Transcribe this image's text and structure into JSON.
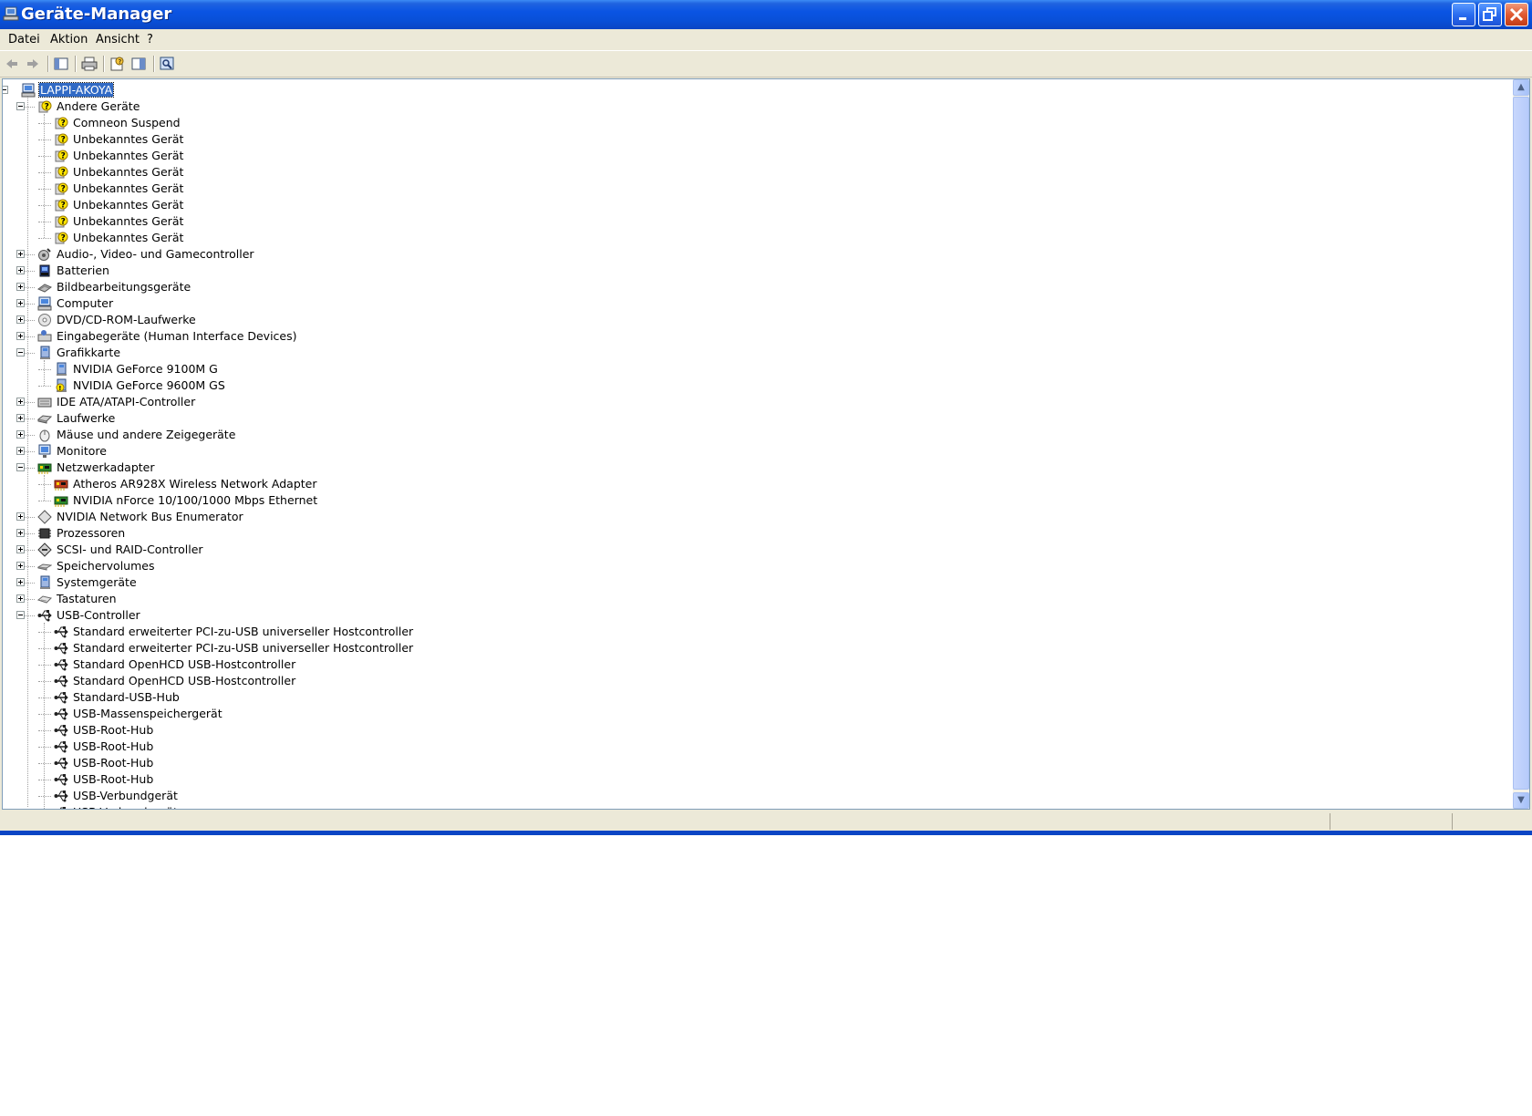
{
  "window": {
    "title": "Geräte-Manager"
  },
  "menu": {
    "items": [
      "Datei",
      "Aktion",
      "Ansicht",
      "?"
    ]
  },
  "toolbar": {
    "buttons": [
      "back-icon",
      "forward-icon",
      "show-hide-tree-icon",
      "print-icon",
      "properties-icon",
      "help-pane-icon",
      "scan-hardware-icon"
    ]
  },
  "tree": {
    "root": "LAPPI-AKOYA",
    "categories": [
      {
        "label": "Andere Geräte",
        "expanded": true,
        "icon": "unknown-device-icon",
        "children": [
          "Comneon Suspend",
          "Unbekanntes Gerät",
          "Unbekanntes Gerät",
          "Unbekanntes Gerät",
          "Unbekanntes Gerät",
          "Unbekanntes Gerät",
          "Unbekanntes Gerät",
          "Unbekanntes Gerät"
        ]
      },
      {
        "label": "Audio-, Video- und Gamecontroller",
        "expanded": false,
        "icon": "audio-icon"
      },
      {
        "label": "Batterien",
        "expanded": false,
        "icon": "battery-icon"
      },
      {
        "label": "Bildbearbeitungsgeräte",
        "expanded": false,
        "icon": "scanner-icon"
      },
      {
        "label": "Computer",
        "expanded": false,
        "icon": "computer-icon"
      },
      {
        "label": "DVD/CD-ROM-Laufwerke",
        "expanded": false,
        "icon": "dvd-icon"
      },
      {
        "label": "Eingabegeräte (Human Interface Devices)",
        "expanded": false,
        "icon": "hid-icon"
      },
      {
        "label": "Grafikkarte",
        "expanded": true,
        "icon": "display-adapter-icon",
        "children": [
          "NVIDIA GeForce 9100M G",
          "NVIDIA GeForce 9600M GS"
        ]
      },
      {
        "label": "IDE ATA/ATAPI-Controller",
        "expanded": false,
        "icon": "ide-icon"
      },
      {
        "label": "Laufwerke",
        "expanded": false,
        "icon": "disk-drive-icon"
      },
      {
        "label": "Mäuse und andere Zeigegeräte",
        "expanded": false,
        "icon": "mouse-icon"
      },
      {
        "label": "Monitore",
        "expanded": false,
        "icon": "monitor-icon"
      },
      {
        "label": "Netzwerkadapter",
        "expanded": true,
        "icon": "network-adapter-icon",
        "children": [
          "Atheros AR928X Wireless Network Adapter",
          "NVIDIA nForce 10/100/1000 Mbps Ethernet"
        ]
      },
      {
        "label": "NVIDIA Network Bus Enumerator",
        "expanded": false,
        "icon": "bus-enumerator-icon"
      },
      {
        "label": "Prozessoren",
        "expanded": false,
        "icon": "processor-icon"
      },
      {
        "label": "SCSI- und RAID-Controller",
        "expanded": false,
        "icon": "scsi-icon"
      },
      {
        "label": "Speichervolumes",
        "expanded": false,
        "icon": "storage-volume-icon"
      },
      {
        "label": "Systemgeräte",
        "expanded": false,
        "icon": "system-device-icon"
      },
      {
        "label": "Tastaturen",
        "expanded": false,
        "icon": "keyboard-icon"
      },
      {
        "label": "USB-Controller",
        "expanded": true,
        "icon": "usb-icon",
        "children": [
          "Standard erweiterter PCI-zu-USB universeller Hostcontroller",
          "Standard erweiterter PCI-zu-USB universeller Hostcontroller",
          "Standard OpenHCD USB-Hostcontroller",
          "Standard OpenHCD USB-Hostcontroller",
          "Standard-USB-Hub",
          "USB-Massenspeichergerät",
          "USB-Root-Hub",
          "USB-Root-Hub",
          "USB-Root-Hub",
          "USB-Root-Hub",
          "USB-Verbundgerät",
          "USB-Verbundgerät"
        ]
      }
    ]
  },
  "colors": {
    "titlebar": "#0a54e3",
    "selection": "#316ac5",
    "window_face": "#ece9d8",
    "warning_yellow": "#ffe600"
  }
}
